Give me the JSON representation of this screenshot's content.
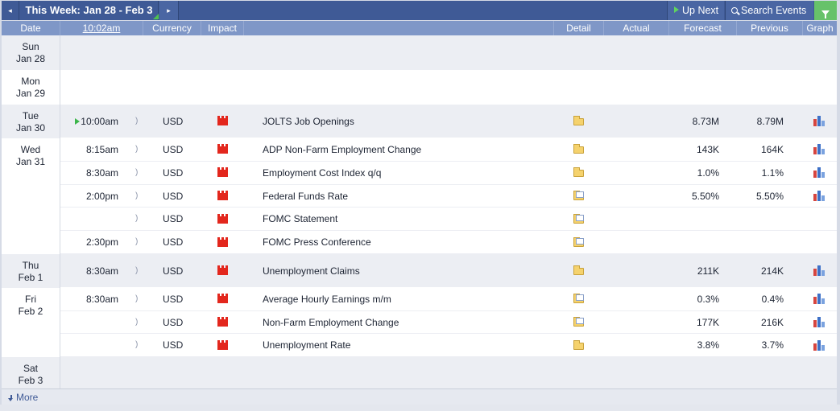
{
  "toolbar": {
    "prev_glyph": "◂",
    "week_title": "This Week: Jan 28 - Feb 3",
    "next_glyph": "▸",
    "up_next": "Up Next",
    "search_events": "Search Events",
    "colors": {
      "bar": "#3f5a96",
      "filter": "#67c26a"
    }
  },
  "header": {
    "date": "Date",
    "time": "10:02am",
    "currency": "Currency",
    "impact": "Impact",
    "detail": "Detail",
    "actual": "Actual",
    "forecast": "Forecast",
    "previous": "Previous",
    "graph": "Graph"
  },
  "days": [
    {
      "weekday": "Sun",
      "date": "Jan 28",
      "events": []
    },
    {
      "weekday": "Mon",
      "date": "Jan 29",
      "events": []
    },
    {
      "weekday": "Tue",
      "date": "Jan 30",
      "events": [
        {
          "time": "10:00am",
          "next": true,
          "currency": "USD",
          "impact": "high",
          "name": "JOLTS Job Openings",
          "detail": "folder",
          "actual": "",
          "forecast": "8.73M",
          "previous": "8.79M",
          "graph": true
        }
      ]
    },
    {
      "weekday": "Wed",
      "date": "Jan 31",
      "events": [
        {
          "time": "8:15am",
          "currency": "USD",
          "impact": "high",
          "name": "ADP Non-Farm Employment Change",
          "detail": "folder",
          "actual": "",
          "forecast": "143K",
          "previous": "164K",
          "graph": true
        },
        {
          "time": "8:30am",
          "currency": "USD",
          "impact": "high",
          "name": "Employment Cost Index q/q",
          "detail": "folder",
          "actual": "",
          "forecast": "1.0%",
          "previous": "1.1%",
          "graph": true
        },
        {
          "time": "2:00pm",
          "currency": "USD",
          "impact": "high",
          "name": "Federal Funds Rate",
          "detail": "folder-doc",
          "actual": "",
          "forecast": "5.50%",
          "previous": "5.50%",
          "graph": true
        },
        {
          "time": "",
          "currency": "USD",
          "impact": "high",
          "name": "FOMC Statement",
          "detail": "folder-doc",
          "actual": "",
          "forecast": "",
          "previous": "",
          "graph": false
        },
        {
          "time": "2:30pm",
          "currency": "USD",
          "impact": "high",
          "name": "FOMC Press Conference",
          "detail": "folder-doc",
          "actual": "",
          "forecast": "",
          "previous": "",
          "graph": false
        }
      ]
    },
    {
      "weekday": "Thu",
      "date": "Feb 1",
      "events": [
        {
          "time": "8:30am",
          "currency": "USD",
          "impact": "high",
          "name": "Unemployment Claims",
          "detail": "folder",
          "actual": "",
          "forecast": "211K",
          "previous": "214K",
          "graph": true
        }
      ]
    },
    {
      "weekday": "Fri",
      "date": "Feb 2",
      "events": [
        {
          "time": "8:30am",
          "currency": "USD",
          "impact": "high",
          "name": "Average Hourly Earnings m/m",
          "detail": "folder-doc",
          "actual": "",
          "forecast": "0.3%",
          "previous": "0.4%",
          "graph": true
        },
        {
          "time": "",
          "currency": "USD",
          "impact": "high",
          "name": "Non-Farm Employment Change",
          "detail": "folder-doc",
          "actual": "",
          "forecast": "177K",
          "previous": "216K",
          "graph": true
        },
        {
          "time": "",
          "currency": "USD",
          "impact": "high",
          "name": "Unemployment Rate",
          "detail": "folder",
          "actual": "",
          "forecast": "3.8%",
          "previous": "3.7%",
          "graph": true
        }
      ]
    },
    {
      "weekday": "Sat",
      "date": "Feb 3",
      "events": []
    }
  ],
  "footer": {
    "more": "More"
  }
}
